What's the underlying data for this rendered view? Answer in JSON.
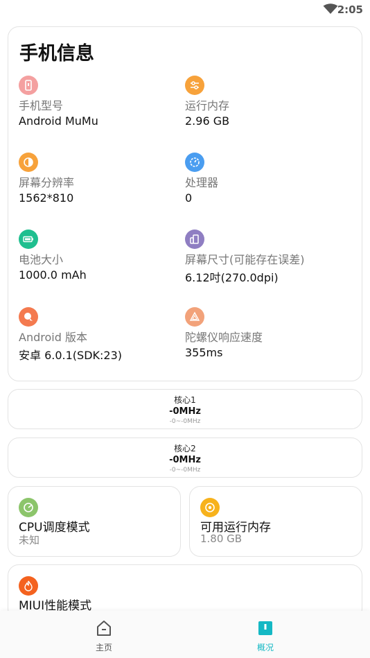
{
  "status_bar": {
    "time": "2:05"
  },
  "info": {
    "title": "手机信息",
    "items": [
      {
        "label": "手机型号",
        "value": "Android MuMu",
        "icon": "phone-icon",
        "color": "#f4a0a0"
      },
      {
        "label": "运行内存",
        "value": "2.96 GB",
        "icon": "sliders-icon",
        "color": "#f7a23b"
      },
      {
        "label": "屏幕分辨率",
        "value": "1562*810",
        "icon": "contrast-icon",
        "color": "#f7a23b"
      },
      {
        "label": "处理器",
        "value": "0",
        "icon": "cpu-gauge-icon",
        "color": "#4a9df0"
      },
      {
        "label": "电池大小",
        "value": "1000.0 mAh",
        "icon": "battery-icon",
        "color": "#1fbf8f"
      },
      {
        "label": "屏幕尺寸(可能存在误差)",
        "value": "6.12吋(270.0dpi)",
        "icon": "screen-size-icon",
        "color": "#8f7ec2"
      },
      {
        "label": "Android 版本",
        "value": "安卓 6.0.1(SDK:23)",
        "icon": "android-icon",
        "color": "#f47a4f"
      },
      {
        "label": "陀螺仪响应速度",
        "value": "355ms",
        "icon": "gyroscope-icon",
        "color": "#f2a27a"
      }
    ]
  },
  "cores": [
    {
      "name": "核心1",
      "freq": "-0MHz",
      "range": "-0~-0MHz"
    },
    {
      "name": "核心2",
      "freq": "-0MHz",
      "range": "-0~-0MHz"
    }
  ],
  "cpu_mode": {
    "title": "CPU调度模式",
    "value": "未知",
    "icon": "cpu-mode-icon",
    "color": "#8cc56b"
  },
  "free_memory": {
    "title": "可用运行内存",
    "value": "1.80 GB",
    "icon": "memory-icon",
    "color": "#f7b21c"
  },
  "miui_perf": {
    "title": "MIUI性能模式",
    "icon": "flame-icon",
    "color": "#f4621f"
  },
  "nav": {
    "home_label": "主页",
    "overview_label": "概况",
    "active_color": "#14b8c4"
  }
}
